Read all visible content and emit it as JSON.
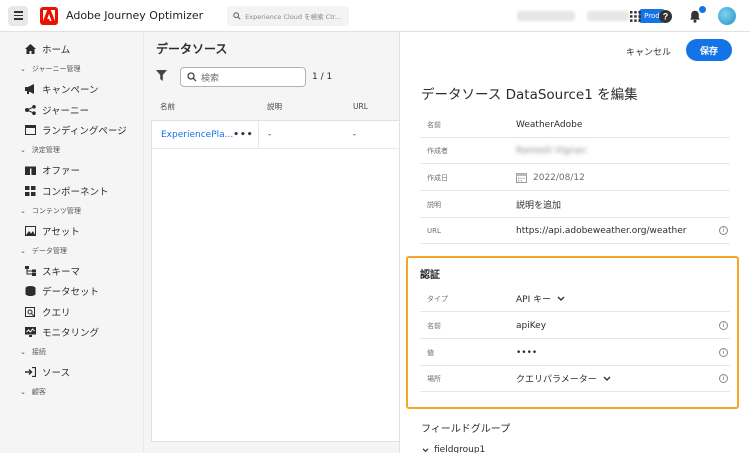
{
  "app": {
    "title": "Adobe Journey Optimizer",
    "env_badge": "Prod"
  },
  "search": {
    "placeholder": "Experience Cloud を検索 Ctr..."
  },
  "sidebar": {
    "home": "ホーム",
    "sections": [
      {
        "label": "ジャーニー管理",
        "items": [
          "キャンペーン",
          "ジャーニー",
          "ランディングページ"
        ]
      },
      {
        "label": "決定管理",
        "items": [
          "オファー",
          "コンポーネント"
        ]
      },
      {
        "label": "コンテンツ管理",
        "items": [
          "アセット"
        ]
      },
      {
        "label": "データ管理",
        "items": [
          "スキーマ",
          "データセット",
          "クエリ",
          "モニタリング"
        ]
      },
      {
        "label": "接続",
        "items": [
          "ソース"
        ]
      },
      {
        "label": "顧客",
        "items": []
      }
    ]
  },
  "list": {
    "title": "データソース",
    "search_placeholder": "検索",
    "count": "1 / 1",
    "columns": [
      "名前",
      "説明",
      "URL"
    ],
    "rows": [
      {
        "name": "ExperiencePla...",
        "desc": "-",
        "url": "-"
      }
    ]
  },
  "detail": {
    "cancel": "キャンセル",
    "save": "保存",
    "title": "データソース DataSource1 を編集",
    "fields": [
      {
        "label": "名前",
        "value": "WeatherAdobe"
      },
      {
        "label": "作成者",
        "value": "Ramesh Vignan"
      },
      {
        "label": "作成日",
        "value": "2022/08/12"
      },
      {
        "label": "説明",
        "value": "説明を追加"
      },
      {
        "label": "URL",
        "value": "https://api.adobeweather.org/weather"
      }
    ],
    "auth": {
      "title": "認証",
      "fields": [
        {
          "label": "タイプ",
          "value": "API キー"
        },
        {
          "label": "名前",
          "value": "apiKey"
        },
        {
          "label": "値",
          "value": "••••"
        },
        {
          "label": "場所",
          "value": "クエリパラメーター"
        }
      ]
    },
    "field_groups_title": "フィールドグループ",
    "field_group": "fieldgroup1"
  },
  "colors": {
    "accent": "#1473e6",
    "highlight": "#f5a623",
    "brand": "#eb1000"
  }
}
